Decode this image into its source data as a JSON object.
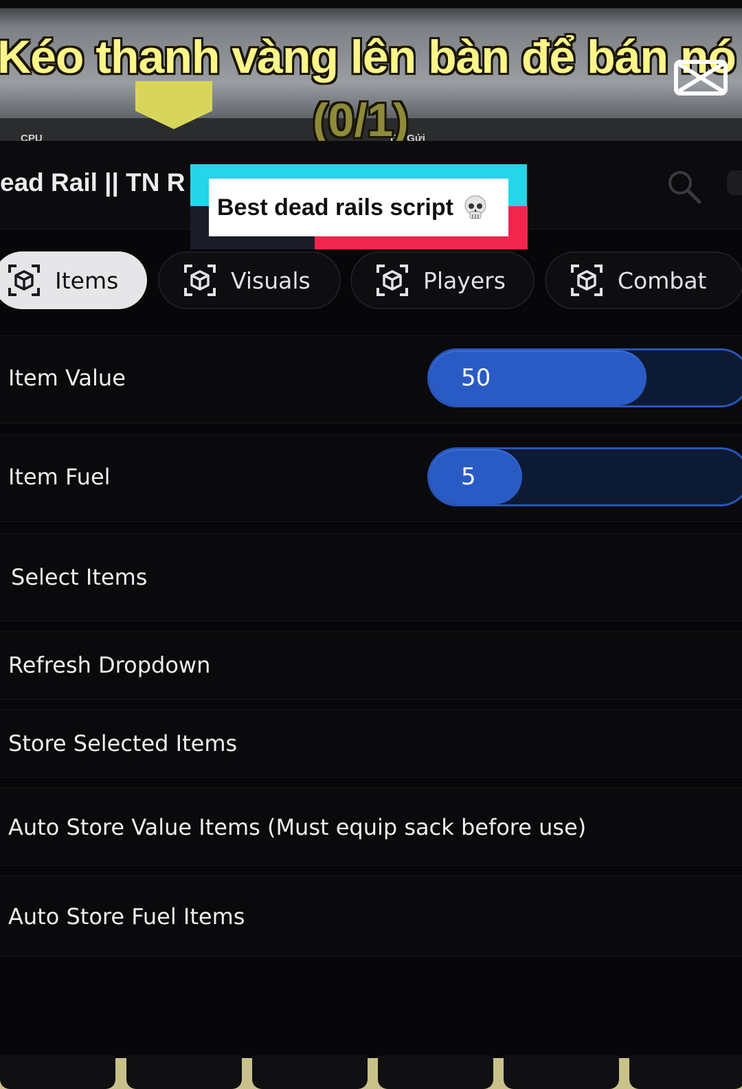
{
  "overlay": {
    "caption_line1": "Kéo thanh vàng lên bàn để bán nó",
    "caption_line2": "(0/1)",
    "hud_left": "CPU",
    "hud_right": "Bỏ Gửi"
  },
  "window": {
    "title": "ead Rail || TN R"
  },
  "tabs": [
    {
      "label": "Items",
      "active": true
    },
    {
      "label": "Visuals",
      "active": false
    },
    {
      "label": "Players",
      "active": false
    },
    {
      "label": "Combat",
      "active": false
    }
  ],
  "sliders": [
    {
      "label": "Item Value",
      "value": "50",
      "fill_fraction": 0.68
    },
    {
      "label": "Item Fuel",
      "value": "5",
      "fill_fraction": 0.29
    }
  ],
  "rows": {
    "select_items": "Select Items",
    "refresh_dropdown": "Refresh Dropdown",
    "store_selected": "Store Selected Items",
    "auto_store_value": "Auto Store Value Items (Must equip sack before use)",
    "auto_store_fuel": "Auto Store Fuel Items"
  },
  "sticker": {
    "text": "Best dead rails script",
    "emoji_icon": "skull-icon"
  },
  "colors": {
    "accent_blue": "#2a5bc4",
    "caption_yellow": "#fbf58a",
    "sticker_cyan": "#25d5e8",
    "sticker_red": "#f2264d"
  }
}
